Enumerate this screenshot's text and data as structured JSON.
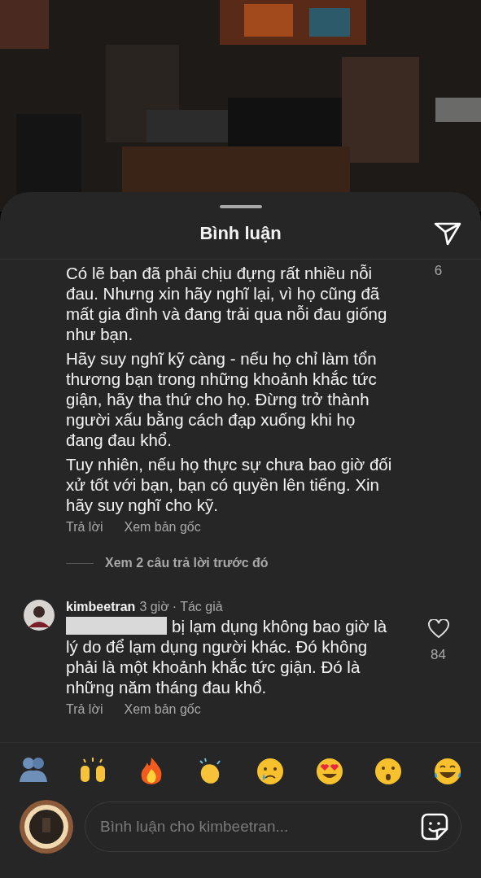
{
  "sheet": {
    "title": "Bình luận"
  },
  "comments": [
    {
      "kind": "plain",
      "paragraphs": [
        "Có lẽ bạn đã phải chịu đựng rất nhiều nỗi đau. Nhưng xin hãy nghĩ lại, vì họ cũng đã mất gia đình và đang trải qua nỗi đau giống như bạn.",
        "Hãy suy nghĩ kỹ càng - nếu họ chỉ làm tổn thương bạn trong những khoảnh khắc tức giận, hãy tha thứ cho họ. Đừng trở thành người xấu bằng cách đạp xuống khi họ đang đau khổ.",
        "Tuy nhiên, nếu họ thực sự chưa bao giờ đối xử tốt với bạn, bạn có quyền lên tiếng. Xin hãy suy nghĩ cho kỹ."
      ],
      "likes": "6",
      "actions": [
        "Trả lời",
        "Xem bản gốc"
      ]
    },
    {
      "kind": "toggle",
      "label": "Xem 2 câu trả lời trước đó"
    },
    {
      "kind": "reply",
      "username": "kimbeetran",
      "time": "3 giờ",
      "badge": "· Tác giả",
      "redacted_mention": true,
      "paragraphs": [
        "bị lạm dụng không bao giờ là lý do để lạm dụng người khác. Đó không phải là một khoảnh khắc tức giận. Đó là những năm tháng đau khổ."
      ],
      "likes": "84",
      "liked": false,
      "actions": [
        "Trả lời",
        "Xem bản gốc"
      ]
    }
  ],
  "reactions": [
    {
      "kind": "hug"
    },
    {
      "kind": "raised"
    },
    {
      "kind": "fire"
    },
    {
      "kind": "clap"
    },
    {
      "kind": "cry"
    },
    {
      "kind": "hearteyes"
    },
    {
      "kind": "wow"
    },
    {
      "kind": "laugh"
    }
  ],
  "composer": {
    "placeholder": "Bình luận cho kimbeetran..."
  }
}
